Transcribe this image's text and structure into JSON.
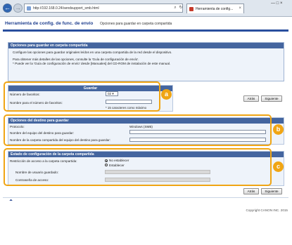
{
  "browser": {
    "url": "http://192.168.0.24/sendsupport_smb.html",
    "tab_title": "Herramienta de config...",
    "tab_close": "×",
    "win_controls": "— □ ×",
    "addr_controls": {
      "search": "⌕",
      "refresh": "↻"
    },
    "nav": {
      "back": "←",
      "forward": "→"
    }
  },
  "header": {
    "title": "Herramienta de config. de func. de envío",
    "subtitle": "Opciones para guardar en carpeta compartida"
  },
  "intro": {
    "heading": "Opciones para guardar en carpeta compartida",
    "line1": "Configure las opciones para guardar originales leídos en una carpeta compartida de la red desde el dispositivo.",
    "line2": "Para obtener más detalles de las opciones, consulte la 'Guía de configuración de envío'.",
    "line3": "* Puede ver la 'Guía de configuración de envío' desde [Manuales] del CD-ROM de instalación de este manual."
  },
  "buttons": {
    "apply": "Atrás",
    "next": "Siguiente"
  },
  "section_a": {
    "heading": "Guardar",
    "favorites_label": "Número de favoritos:",
    "favorites_value": "02",
    "favorites_name_label": "Nombre para el número de favoritos:",
    "favorites_name_value": "",
    "max_note": "* 15 caracteres como máximo",
    "badge": "a"
  },
  "section_b": {
    "heading": "Opciones del destino para guardar",
    "protocol_label": "Protocolo:",
    "protocol_value": "Windows (SMB)",
    "host_label": "Nombre del equipo del destino para guardar:",
    "host_value": "",
    "folder_label": "Nombre de la carpeta compartida del equipo del destino para guardar:",
    "folder_value": "",
    "badge": "b"
  },
  "section_c": {
    "heading": "Estado de configuración de la carpeta compartida",
    "restrict_label": "Restricción de acceso a la carpeta compartida:",
    "opt_off": "No establecer",
    "opt_on": "Establecer",
    "user_label": "Nombre de usuario guardado:",
    "password_label": "Contraseña de acceso:",
    "badge": "c"
  },
  "footer": {
    "top_link": "⏶",
    "copyright": "Copyright CANON INC. 2015"
  },
  "colors": {
    "accent": "#f0a514",
    "section_header": "#44659f",
    "title": "#1f3f8f"
  }
}
